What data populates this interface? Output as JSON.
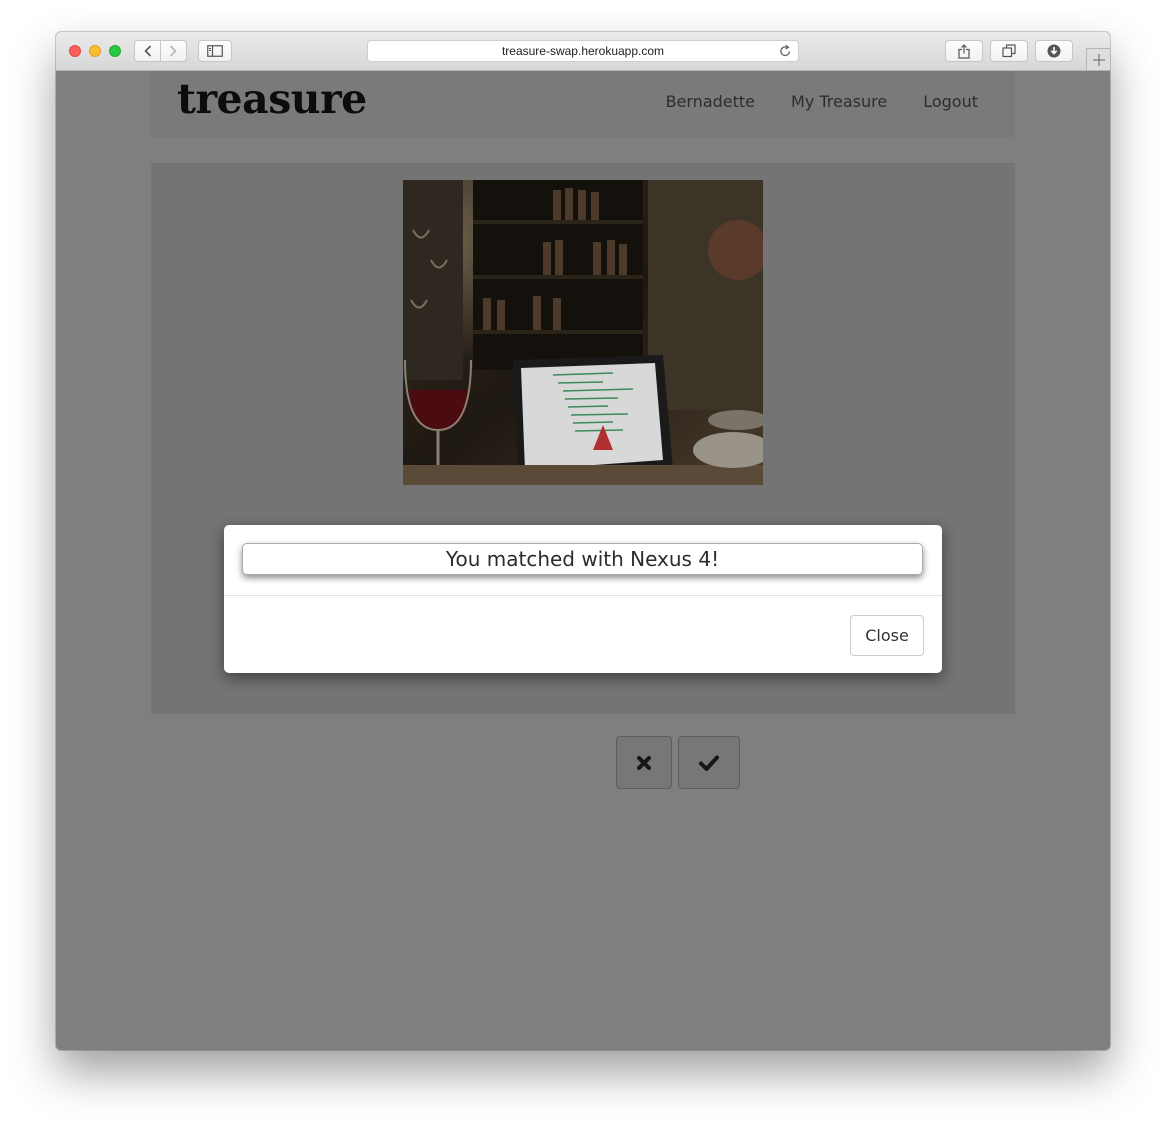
{
  "browser": {
    "url": "treasure-swap.herokuapp.com",
    "icons": {
      "back": "chevron-left-icon",
      "forward": "chevron-right-icon",
      "sidebar": "sidebar-icon",
      "reload": "reload-icon",
      "share": "share-icon",
      "tabs": "tabs-icon",
      "downloads": "download-icon",
      "new_tab": "plus-icon"
    }
  },
  "navbar": {
    "brand": "treasure",
    "links": [
      "Bernadette",
      "My Treasure",
      "Logout"
    ]
  },
  "item": {
    "image": "photo of laptop with code on screen beside wine glass in a wine bar"
  },
  "modal": {
    "title": "You matched with Nexus 4!",
    "close_label": "Close"
  },
  "actions": {
    "reject_icon": "x-icon",
    "accept_icon": "checkmark-icon"
  },
  "colors": {
    "overlay": "#7f7f7f",
    "brand_text": "#0c0c0c",
    "modal_bg": "#ffffff"
  }
}
